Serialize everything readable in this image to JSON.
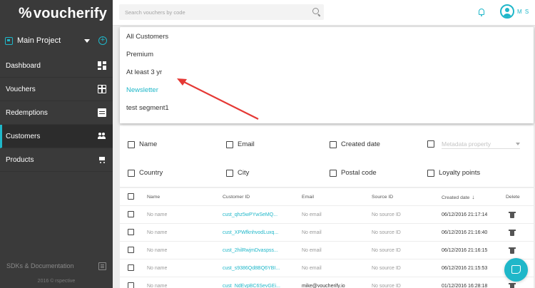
{
  "app": {
    "name": "voucherify",
    "logo_mark": "%"
  },
  "sidebar": {
    "project": "Main Project",
    "items": [
      {
        "label": "Dashboard",
        "icon": "dashboard-icon"
      },
      {
        "label": "Vouchers",
        "icon": "gift-icon"
      },
      {
        "label": "Redemptions",
        "icon": "list-icon"
      },
      {
        "label": "Customers",
        "icon": "people-icon",
        "active": true
      },
      {
        "label": "Products",
        "icon": "cart-icon"
      }
    ],
    "sdk_label": "SDKs & Documentation",
    "copyright": "2016 © rspective"
  },
  "topbar": {
    "search_placeholder": "Search vouchers by code",
    "user_initials": "M S"
  },
  "dropdown": {
    "items": [
      "All Customers",
      "Premium",
      "At least 3 yr",
      "Newsletter",
      "test segment1"
    ],
    "selected": "Newsletter"
  },
  "filters": {
    "row1": [
      "Name",
      "Email",
      "Created date"
    ],
    "metadata_placeholder": "Metadata property",
    "row2": [
      "Country",
      "City",
      "Postal code",
      "Loyalty points"
    ]
  },
  "table": {
    "headers": {
      "name": "Name",
      "customer_id": "Customer ID",
      "email": "Email",
      "source_id": "Source ID",
      "created": "Created date",
      "delete": "Delete"
    },
    "rows": [
      {
        "name": "No name",
        "customer_id": "cust_qhz5wPYwSeMQ...",
        "email": "No email",
        "source_id": "No source ID",
        "created": "06/12/2016 21:17:14"
      },
      {
        "name": "No name",
        "customer_id": "cust_XPWfknhvodLuxq...",
        "email": "No email",
        "source_id": "No source ID",
        "created": "06/12/2016 21:16:40"
      },
      {
        "name": "No name",
        "customer_id": "cust_2hilRwjmDvaspss...",
        "email": "No email",
        "source_id": "No source ID",
        "created": "06/12/2016 21:16:15"
      },
      {
        "name": "No name",
        "customer_id": "cust_s9386Qd8BQ6YBI...",
        "email": "No email",
        "source_id": "No source ID",
        "created": "06/12/2016 21:15:53"
      },
      {
        "name": "No name",
        "customer_id": "cust_NdEvpBC6SevGEi...",
        "email": "mike@voucherify.io",
        "source_id": "No source ID",
        "created": "01/12/2016 16:28:18"
      }
    ]
  },
  "colors": {
    "accent": "#1fb7c9",
    "sidebar": "#3a3a3a",
    "annotation": "#e53935"
  }
}
